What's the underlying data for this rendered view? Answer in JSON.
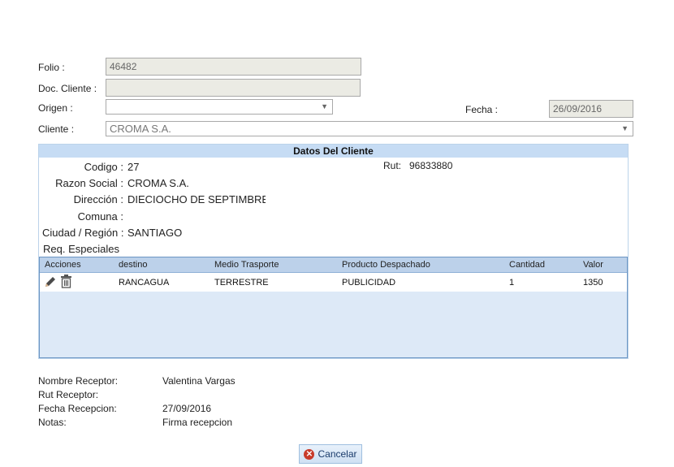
{
  "form": {
    "folio_label": "Folio :",
    "folio_value": "46482",
    "doc_label": "Doc. Cliente :",
    "doc_value": "",
    "origen_label": "Origen :",
    "origen_value": "",
    "fecha_label": "Fecha :",
    "fecha_value": "26/09/2016",
    "cliente_label": "Cliente :",
    "cliente_value": "CROMA S.A."
  },
  "cliente_panel": {
    "title": "Datos Del Cliente",
    "codigo_label": "Codigo :",
    "codigo_value": "27",
    "rut_label": "Rut:",
    "rut_value": "96833880",
    "razon_label": "Razon Social :",
    "razon_value": "CROMA S.A.",
    "direccion_label": "Dirección :",
    "direccion_value": "DIECIOCHO DE SEPTIMBRE",
    "comuna_label": "Comuna :",
    "comuna_value": "",
    "ciudad_label": "Ciudad / Región :",
    "ciudad_value": "SANTIAGO",
    "req_label": "Req. Especiales"
  },
  "grid": {
    "headers": [
      "Acciones",
      "destino",
      "Medio Trasporte",
      "Producto Despachado",
      "Cantidad",
      "Valor"
    ],
    "rows": [
      {
        "destino": "RANCAGUA",
        "medio": "TERRESTRE",
        "producto": "PUBLICIDAD",
        "cantidad": "1",
        "valor": "1350"
      }
    ]
  },
  "receptor": {
    "nombre_label": "Nombre Receptor:",
    "nombre_value": "Valentina Vargas",
    "rut_label": "Rut Receptor:",
    "rut_value": "",
    "fecha_label": "Fecha Recepcion:",
    "fecha_value": "27/09/2016",
    "notas_label": "Notas:",
    "notas_value": "Firma recepcion"
  },
  "actions": {
    "cancel_label": "Cancelar"
  },
  "icons": {
    "edit": "pencil-icon",
    "delete": "trash-icon",
    "cancel": "close-circle-icon"
  },
  "colors": {
    "panel_header": "#c6dcf4",
    "grid_body": "#dde9f7",
    "cancel_icon": "#c83a2a"
  }
}
